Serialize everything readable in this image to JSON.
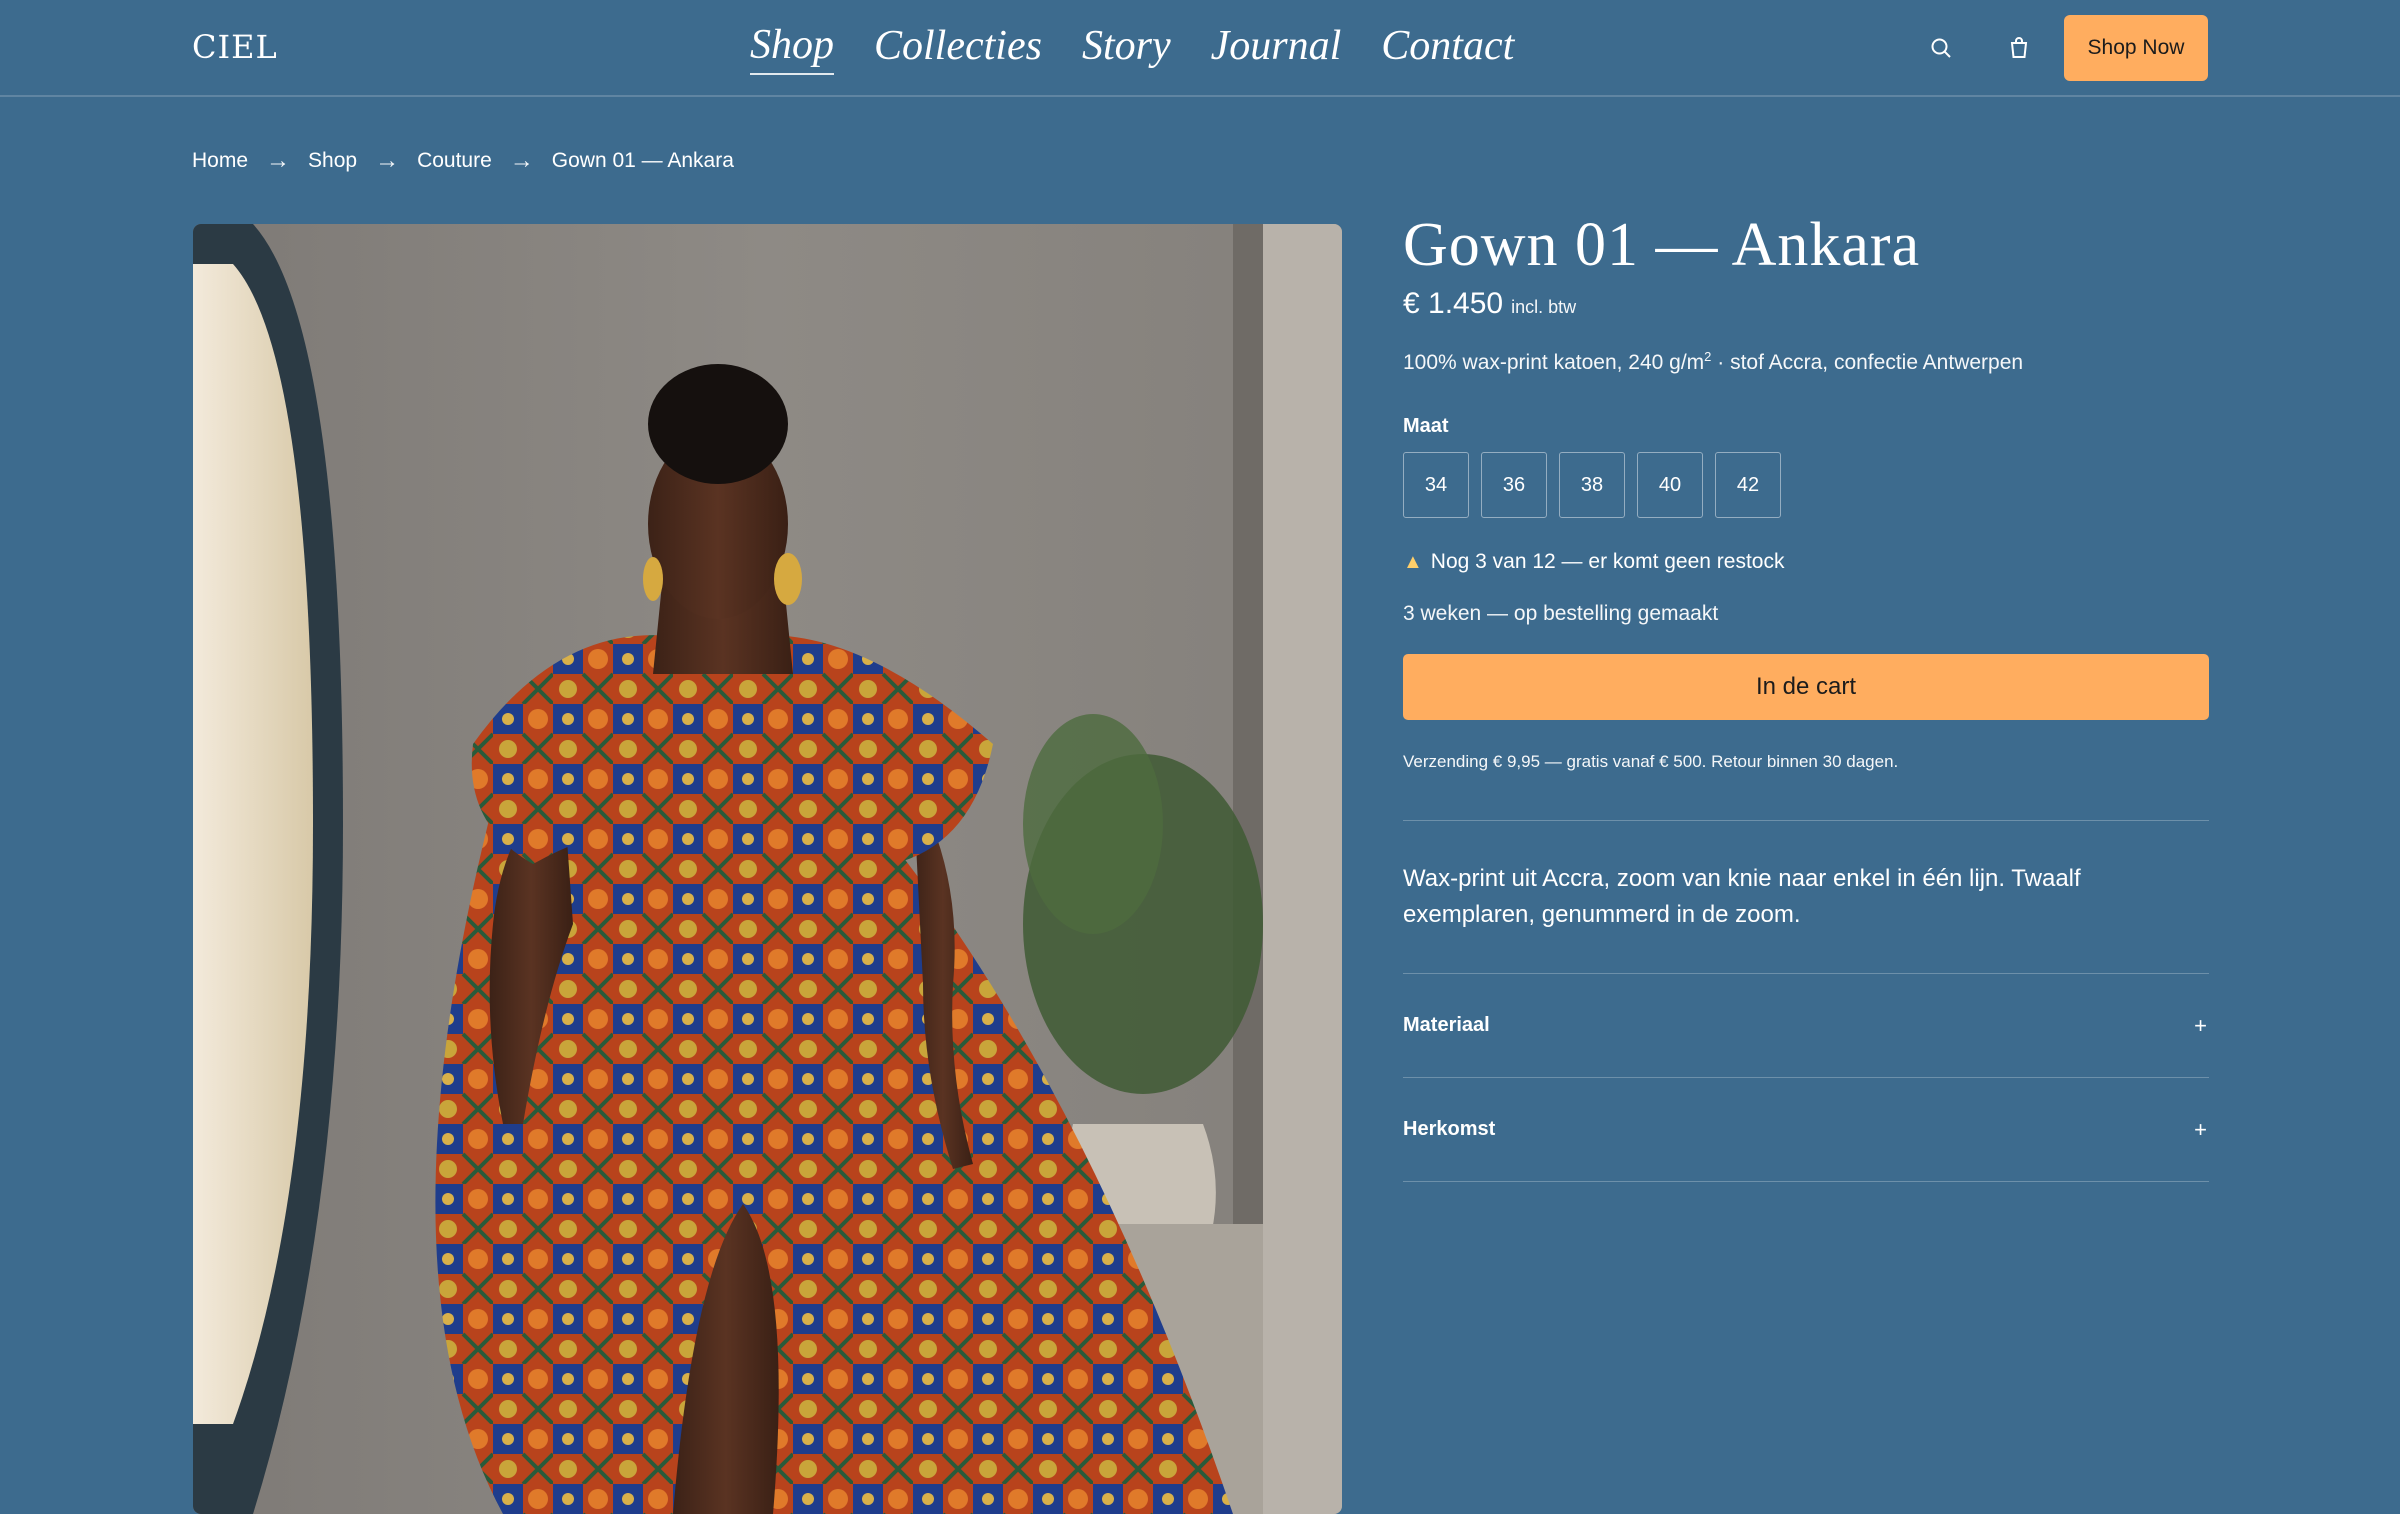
{
  "brand": {
    "logo": "CIEL"
  },
  "nav": {
    "items": [
      {
        "label": "Shop",
        "active": true
      },
      {
        "label": "Collecties"
      },
      {
        "label": "Story"
      },
      {
        "label": "Journal"
      },
      {
        "label": "Contact"
      }
    ]
  },
  "header": {
    "search_icon": "search-icon",
    "cart_icon": "shopping-bag-icon",
    "cta_label": "Shop Now"
  },
  "breadcrumb": {
    "items": [
      "Home",
      "Shop",
      "Couture",
      "Gown 01 — Ankara"
    ],
    "separator": "→"
  },
  "product": {
    "image_alt": "Model in Ankara wax-print gown",
    "title": "Gown 01 — Ankara",
    "price": "€ 1.450",
    "price_note": "incl. btw",
    "specs_part1": "100% wax-print katoen, 240 g/m",
    "specs_sup": "2",
    "specs_part2": " · stof Accra, confectie Antwerpen",
    "size_label": "Maat",
    "sizes": [
      "34",
      "36",
      "38",
      "40",
      "42"
    ],
    "stock_icon": "▲",
    "stock_text": "Nog 3 van 12 — er komt geen restock",
    "lead_time": "3 weken — op bestelling gemaakt",
    "cart_label": "In de cart",
    "shipping_note": "Verzending € 9,95 — gratis vanaf € 500. Retour binnen 30 dagen.",
    "description": "Wax-print uit Accra, zoom van knie naar enkel in één lijn. Twaalf exemplaren, genummerd in de zoom.",
    "accordion": [
      {
        "label": "Materiaal",
        "toggle": "+"
      },
      {
        "label": "Herkomst",
        "toggle": "+"
      }
    ]
  },
  "colors": {
    "background": "#3d6b8e",
    "accent": "#ffad5f",
    "text": "#ffffff",
    "warning": "#ffcf6a"
  }
}
